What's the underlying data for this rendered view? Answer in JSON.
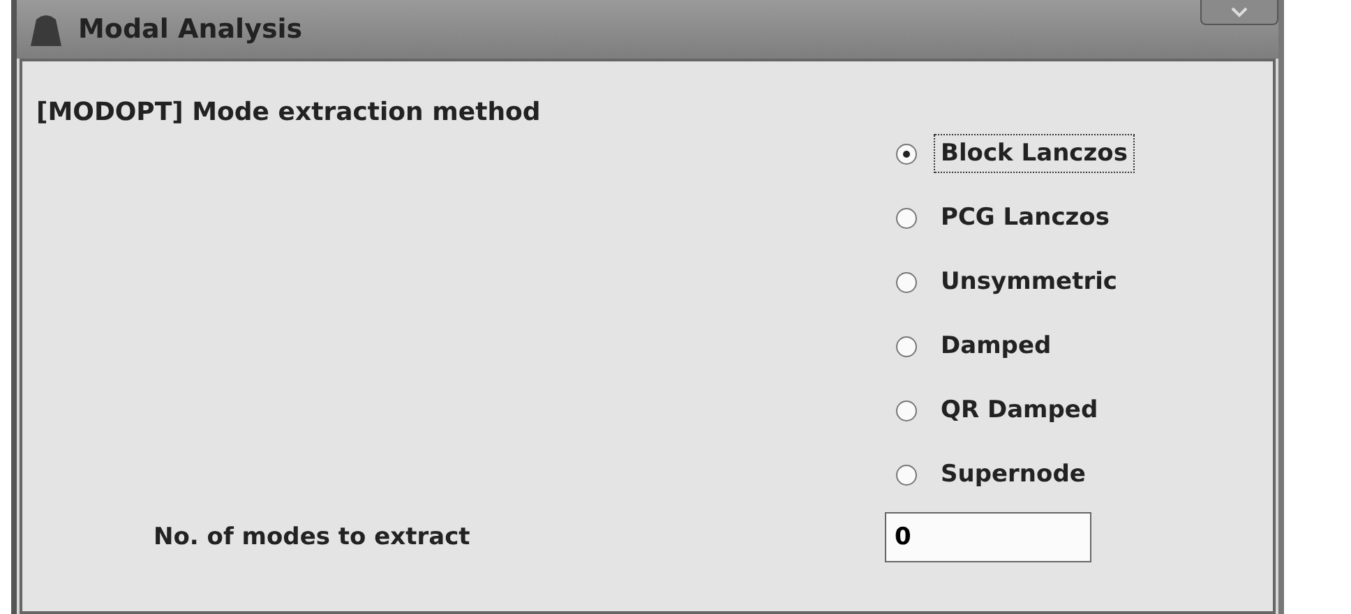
{
  "window": {
    "title": "Modal Analysis"
  },
  "section": {
    "label": "[MODOPT] Mode extraction method"
  },
  "methods": [
    {
      "label": "Block Lanczos",
      "selected": true
    },
    {
      "label": "PCG Lanczos",
      "selected": false
    },
    {
      "label": "Unsymmetric",
      "selected": false
    },
    {
      "label": "Damped",
      "selected": false
    },
    {
      "label": "QR Damped",
      "selected": false
    },
    {
      "label": "Supernode",
      "selected": false
    }
  ],
  "modes_field": {
    "label": "No. of modes to extract",
    "value": "0"
  }
}
